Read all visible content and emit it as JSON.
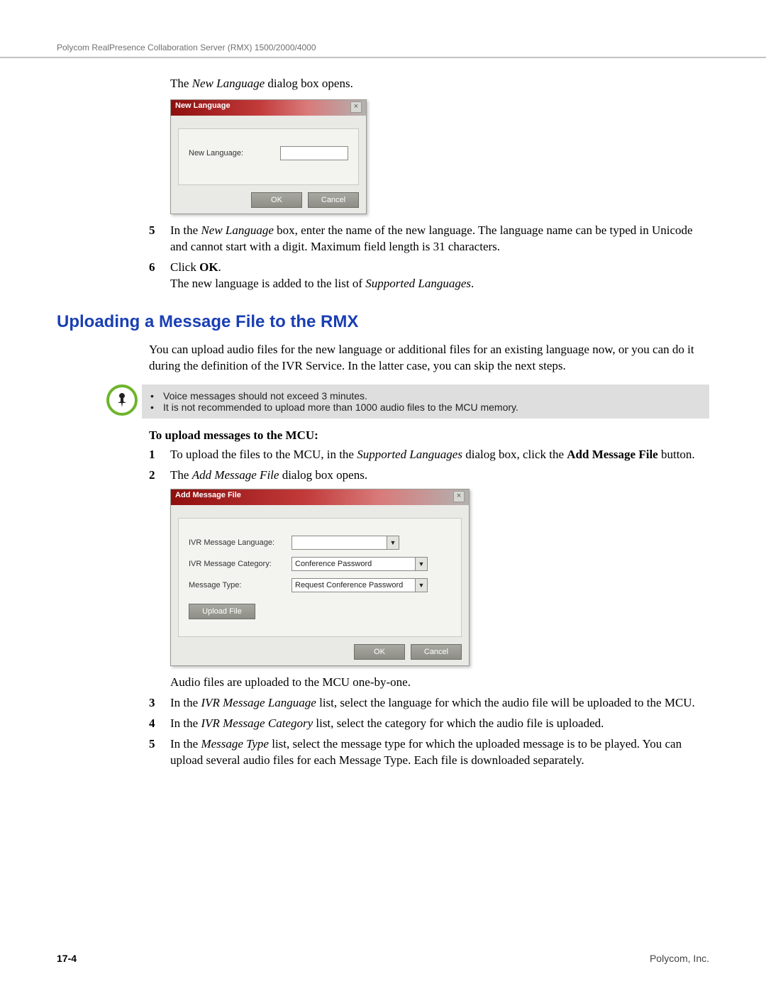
{
  "header": {
    "title": "Polycom RealPresence Collaboration Server (RMX) 1500/2000/4000"
  },
  "intro": {
    "prefix": "The ",
    "italic": "New Language",
    "suffix": " dialog box opens."
  },
  "dialog_new_language": {
    "title": "New Language",
    "close": "×",
    "label": "New Language:",
    "ok": "OK",
    "cancel": "Cancel"
  },
  "steps_a": {
    "s5": {
      "num": "5",
      "t1": "In the ",
      "it1": "New Language",
      "t2": " box, enter the name of the new language. The language name can be typed in Unicode and cannot start with a digit. Maximum field length is 31 characters."
    },
    "s6": {
      "num": "6",
      "t1": "Click ",
      "b1": "OK",
      "t2": ".",
      "line2a": "The new language is added to the list of ",
      "line2it": "Supported Languages",
      "line2b": "."
    }
  },
  "section_heading": "Uploading a Message File to the RMX",
  "section_intro": "You can upload audio files for the new language or additional files for an existing language now, or you can do it during the definition of the IVR Service. In the latter case, you can skip the next steps.",
  "note": {
    "b1": "Voice messages should not exceed 3 minutes.",
    "b2": "It is not recommended to upload more than 1000 audio files to the MCU memory."
  },
  "sub_heading": "To upload messages to the MCU:",
  "steps_b": {
    "s1": {
      "num": "1",
      "t1": "To upload the files to the MCU, in the ",
      "it1": "Supported Languages",
      "t2": " dialog box, click the ",
      "b1": "Add Message File",
      "t3": " button."
    },
    "s2": {
      "num": "2",
      "t1": "The ",
      "it1": "Add Message File",
      "t2": " dialog box opens."
    },
    "s2_after": "Audio files are uploaded to the MCU one-by-one.",
    "s3": {
      "num": "3",
      "t1": "In the ",
      "it1": "IVR Message Language",
      "t2": " list, select the language for which the audio file will be uploaded to the MCU."
    },
    "s4": {
      "num": "4",
      "t1": "In the ",
      "it1": "IVR Message Category",
      "t2": " list, select the category for which the audio file is uploaded."
    },
    "s5": {
      "num": "5",
      "t1": "In the ",
      "it1": "Message Type",
      "t2": " list, select the message type for which the uploaded message is to be played. You can upload several audio files for each Message Type. Each file is downloaded separately."
    }
  },
  "dialog_add_message": {
    "title": "Add Message File",
    "close": "×",
    "l1": "IVR Message Language:",
    "l2": "IVR Message Category:",
    "l3": "Message Type:",
    "v2": "Conference Password",
    "v3": "Request Conference Password",
    "upload": "Upload File",
    "ok": "OK",
    "cancel": "Cancel"
  },
  "footer": {
    "page": "17-4",
    "company": "Polycom, Inc."
  }
}
